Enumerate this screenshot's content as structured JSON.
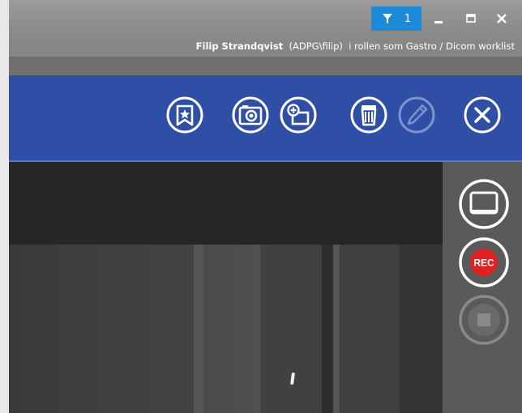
{
  "window": {
    "filter_count": "1",
    "controls": [
      "minimize",
      "maximize",
      "close"
    ]
  },
  "user": {
    "name": "Filip Strandqvist",
    "account": "(ADPG\\filip)",
    "role_text": "i rollen som Gastro / Dicom worklist"
  },
  "toolbar": {
    "buttons": [
      {
        "name": "bookmark",
        "icon": "bookmark-icon",
        "enabled": true
      },
      {
        "name": "capture-image",
        "icon": "camera-icon",
        "enabled": true
      },
      {
        "name": "add-image",
        "icon": "add-image-icon",
        "enabled": true
      },
      {
        "name": "delete",
        "icon": "trash-icon",
        "enabled": true
      },
      {
        "name": "edit",
        "icon": "pencil-icon",
        "enabled": false
      },
      {
        "name": "close",
        "icon": "close-circle-icon",
        "enabled": true
      }
    ]
  },
  "side_panel": {
    "rec_label": "REC",
    "buttons": [
      {
        "name": "display-toggle",
        "icon": "monitor-icon",
        "enabled": true
      },
      {
        "name": "record",
        "icon": "record-icon",
        "enabled": true
      },
      {
        "name": "stop",
        "icon": "stop-icon",
        "enabled": false
      }
    ]
  },
  "colors": {
    "toolbar_bg": "#2f4ea6",
    "filter_badge": "#1d8ad6",
    "record_red": "#e02020"
  }
}
